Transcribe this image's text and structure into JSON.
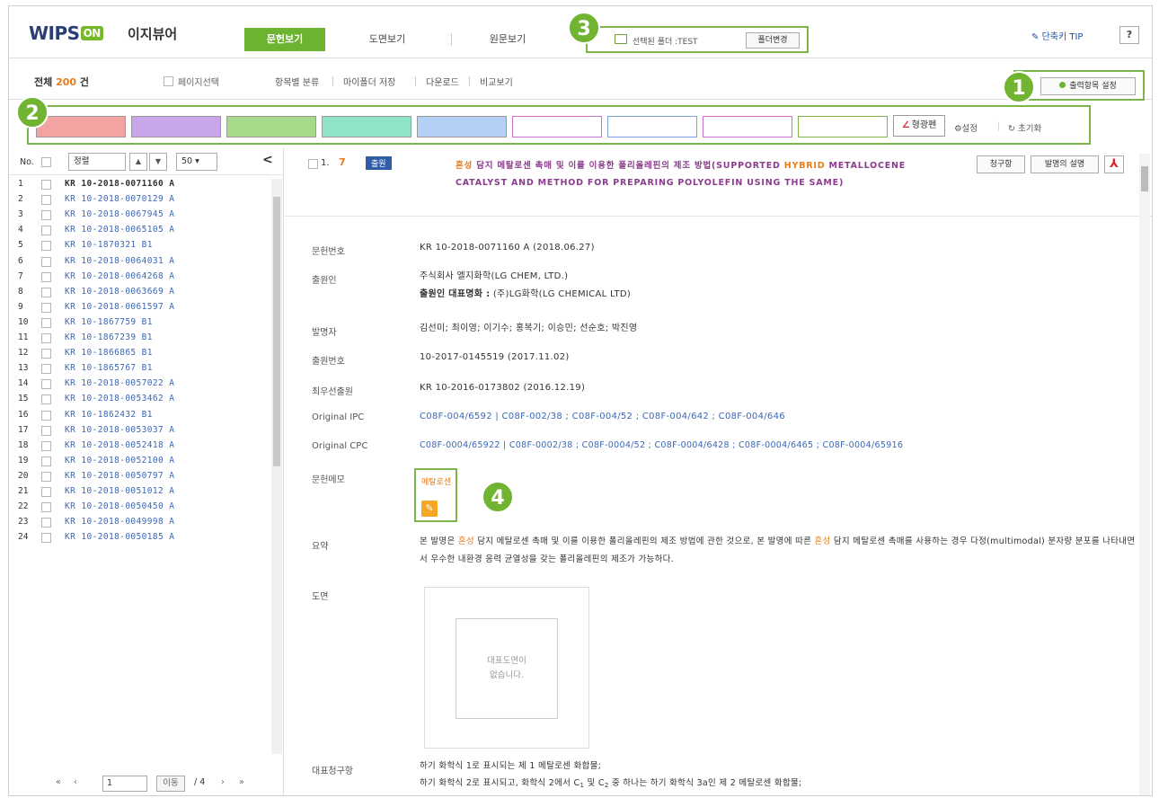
{
  "app": {
    "brand": "WIPS",
    "brand_on": "ON",
    "name": "이지뷰어"
  },
  "tabs": [
    {
      "label": "문헌보기",
      "active": true
    },
    {
      "label": "도면보기"
    },
    {
      "label": "원문보기"
    }
  ],
  "folder": {
    "label": "선택된 폴더 :TEST",
    "change_button": "폴더변경"
  },
  "tip_label": "단축키 TIP",
  "help_label": "?",
  "toolbar": {
    "total_prefix": "전체",
    "total_count": "200",
    "total_suffix": "건",
    "select_all": "페이지선택",
    "links": [
      "항목별 분류",
      "마이폴더 저장",
      "다운로드",
      "비교보기"
    ],
    "output_settings": "출력항목 설정"
  },
  "highlight": {
    "swatch_colors": [
      "#f4a3a3",
      "#c7a6ea",
      "#a6d98a",
      "#8ee3c9",
      "#b3d1f7",
      "#ffffff",
      "#ffffff",
      "#ffffff",
      "#ffffff"
    ],
    "swatch_borders": [
      "#999",
      "#999",
      "#999",
      "#999",
      "#999",
      "#cf6fcf",
      "#7aa3dd",
      "#cf6fcf",
      "#7ab648"
    ],
    "pen_button": "형광펜",
    "settings": "설정",
    "reset": "초기화"
  },
  "badges": [
    "1",
    "2",
    "3",
    "4"
  ],
  "list_header": {
    "no": "No.",
    "sort": "정렬",
    "per_page": "50",
    "collapse": "<"
  },
  "docs": [
    "KR 10-2018-0071160 A",
    "KR 10-2018-0070129 A",
    "KR 10-2018-0067945 A",
    "KR 10-2018-0065105 A",
    "KR 10-1870321 B1",
    "KR 10-2018-0064031 A",
    "KR 10-2018-0064268 A",
    "KR 10-2018-0063669 A",
    "KR 10-2018-0061597 A",
    "KR 10-1867759 B1",
    "KR 10-1867239 B1",
    "KR 10-1866865 B1",
    "KR 10-1865767 B1",
    "KR 10-2018-0057022 A",
    "KR 10-2018-0053462 A",
    "KR 10-1862432 B1",
    "KR 10-2018-0053037 A",
    "KR 10-2018-0052418 A",
    "KR 10-2018-0052100 A",
    "KR 10-2018-0050797 A",
    "KR 10-2018-0051012 A",
    "KR 10-2018-0050450 A",
    "KR 10-2018-0049998 A",
    "KR 10-2018-0050185 A"
  ],
  "pager": {
    "first": "«",
    "prev": "‹",
    "page": "1",
    "go": "이동",
    "total": "/ 4",
    "next": "›",
    "last": "»"
  },
  "detail": {
    "index": "1.",
    "status": "출원",
    "title_hl": "혼성",
    "title_mid": " 담지 메탈로센 촉매 및 이를 이용한 폴리올레핀의 제조 방법(SUPPORTED ",
    "title_hl2": "HYBRID",
    "title_end": " METALLOCENE CATALYST AND METHOD FOR PREPARING POLYOLEFIN USING THE SAME)",
    "btn_claims": "청구항",
    "btn_desc": "발명의 설명",
    "fields": {
      "doc_no_label": "문헌번호",
      "doc_no": "KR 10-2018-0071160 A (2018.06.27)",
      "applicant_label": "출원인",
      "applicant": "주식회사 엘지화학(LG CHEM, LTD.)",
      "rep_applicant_label": "출원인 대표명화 :",
      "rep_applicant": "(주)LG화학(LG CHEMICAL LTD)",
      "inventor_label": "발명자",
      "inventor": "김선미; 최이영; 이기수; 홍복기; 이승민; 선순호; 박진영",
      "app_no_label": "출원번호",
      "app_no": "10-2017-0145519 (2017.11.02)",
      "priority_label": "최우선출원",
      "priority": "KR 10-2016-0173802  (2016.12.19)",
      "ipc_label": "Original IPC",
      "ipc": "C08F-004/6592  |  C08F-002/38 ;  C08F-004/52 ;  C08F-004/642 ;  C08F-004/646",
      "cpc_label": "Original CPC",
      "cpc": "C08F-0004/65922  |  C08F-0002/38 ;  C08F-0004/52 ;  C08F-0004/6428 ;  C08F-0004/6465 ;  C08F-0004/65916",
      "memo_label": "문헌메모",
      "memo": "메탈로센",
      "abstract_label": "요약",
      "abstract_1": "본 발명은 ",
      "abstract_hl": "혼성",
      "abstract_2": " 담지 메탈로센 촉매 및 이를 이용한 폴리올레핀의 제조 방법에 관한 것으로, 본 발명에 따른 ",
      "abstract_hl2": "혼성",
      "abstract_3": " 담지 메탈로센 촉매를 사용하는 경우 다정(multimodal) 분자량 분포를 나타내면서 우수한 내환경 응력 균열성을 갖는 폴리올레핀의 제조가 가능하다.",
      "drawing_label": "도면",
      "drawing_empty": "대표도면이\n없습니다.",
      "claim_label": "대표청구항",
      "claim_1": "하기 화학식 1로 표시되는 제 1 메탈로센 화합물;",
      "claim_2a": "하기 화학식 2로 표시되고, 화학식 2에서 C",
      "claim_2b": "1",
      "claim_2c": " 및 C",
      "claim_2d": "2",
      "claim_2e": " 중 하나는 하기 화학식 3a인 제 2 메탈로센 화합물;"
    }
  }
}
